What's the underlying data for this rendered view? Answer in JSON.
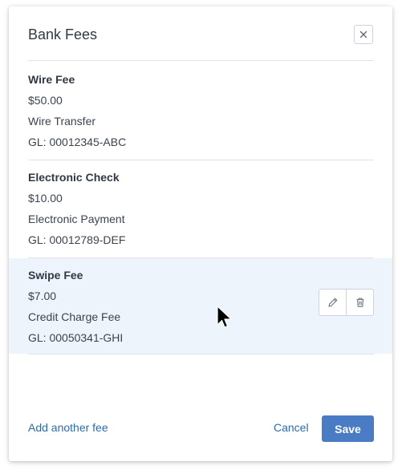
{
  "dialog": {
    "title": "Bank Fees"
  },
  "fees": [
    {
      "name": "Wire Fee",
      "amount": "$50.00",
      "type": "Wire Transfer",
      "gl": "GL: 00012345-ABC"
    },
    {
      "name": "Electronic Check",
      "amount": "$10.00",
      "type": "Electronic Payment",
      "gl": "GL: 00012789-DEF"
    },
    {
      "name": "Swipe Fee",
      "amount": "$7.00",
      "type": "Credit Charge Fee",
      "gl": "GL: 00050341-GHI"
    }
  ],
  "footer": {
    "add_label": "Add another fee",
    "cancel_label": "Cancel",
    "save_label": "Save"
  },
  "colors": {
    "accent": "#4a7cc6",
    "link": "#2a6bb5",
    "row_highlight": "#eef4fb"
  },
  "icons": {
    "close": "close-icon",
    "edit": "pencil-icon",
    "delete": "trash-icon"
  }
}
